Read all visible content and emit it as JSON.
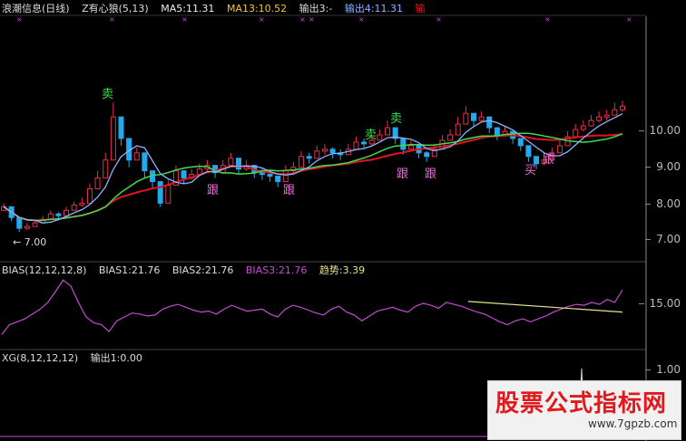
{
  "colors": {
    "up": "#e8314a",
    "down": "#22aaee",
    "ma5": "#eeeeee",
    "ma13": "#f5c33b",
    "out3_green": "#3ddc4b",
    "out3_cyan": "#1fc9d6",
    "out4": "#8ab4ff",
    "out_red": "#e3141f",
    "bias": "#c34bd1",
    "trend": "#e7e28b",
    "axis": "#888888"
  },
  "header": {
    "title": "浪潮信息(日线)",
    "indicator": "Z有心狼(5,13)",
    "ma5": "MA5:11.31",
    "ma13": "MA13:10.52",
    "out3": "输出3:-",
    "out4": "输出4:11.31",
    "out_last": "输"
  },
  "bias_header": {
    "name": "BIAS(12,12,12,8)",
    "bias1": "BIAS1:21.76",
    "bias2": "BIAS2:21.76",
    "bias3": "BIAS3:21.76",
    "trend": "趋势:3.39"
  },
  "xg_header": {
    "name": "XG(8,12,12,12)",
    "out1": "输出1:0.00"
  },
  "price_axis": [
    "10.00",
    "9.00",
    "8.00",
    "7.00"
  ],
  "bias_axis": [
    "15.00"
  ],
  "xg_axis": [
    "1.00"
  ],
  "low_marker": "← 7.00",
  "signals": {
    "sell": "卖",
    "follow": "跟",
    "buy": "买"
  },
  "watermark": {
    "title": "股票公式指标网",
    "url": "www.7gpzb.com"
  },
  "chart_data": [
    {
      "type": "candlestick",
      "title": "浪潮信息(日线)",
      "ylim": [
        6.5,
        11.0
      ],
      "x": [
        1,
        2,
        3,
        4,
        5,
        6,
        7,
        8,
        9,
        10,
        11,
        12,
        13,
        14,
        15,
        16,
        17,
        18,
        19,
        20,
        21,
        22,
        23,
        24,
        25,
        26,
        27,
        28,
        29,
        30,
        31,
        32,
        33,
        34,
        35,
        36,
        37,
        38,
        39,
        40,
        41,
        42,
        43,
        44,
        45,
        46,
        47,
        48,
        49,
        50,
        51,
        52,
        53,
        54,
        55,
        56,
        57,
        58,
        59,
        60,
        61,
        62,
        63,
        64,
        65,
        66,
        67,
        68,
        69,
        70,
        71,
        72,
        73,
        74,
        75,
        76,
        77,
        78,
        79,
        80,
        81,
        82,
        83,
        84,
        85,
        86,
        87,
        88,
        89,
        90
      ],
      "close": [
        7.9,
        7.6,
        7.3,
        7.35,
        7.45,
        7.55,
        7.7,
        7.65,
        7.8,
        7.95,
        8.0,
        8.4,
        8.7,
        9.2,
        10.4,
        9.8,
        9.2,
        9.4,
        8.9,
        8.6,
        8.0,
        8.5,
        8.9,
        8.7,
        8.8,
        8.95,
        9.05,
        8.85,
        9.05,
        9.25,
        8.95,
        9.05,
        8.85,
        8.8,
        8.75,
        8.6,
        8.9,
        9.0,
        9.3,
        9.25,
        9.45,
        9.5,
        9.4,
        9.35,
        9.5,
        9.7,
        9.65,
        9.75,
        9.9,
        10.1,
        9.8,
        9.5,
        9.6,
        9.4,
        9.3,
        9.5,
        9.75,
        9.9,
        10.2,
        10.5,
        10.3,
        10.4,
        10.1,
        9.9,
        10.0,
        9.8,
        9.6,
        9.3,
        9.1,
        9.2,
        9.4,
        9.6,
        9.85,
        10.05,
        10.15,
        10.3,
        10.4,
        10.45,
        10.6,
        10.7
      ],
      "high": [
        8.0,
        7.7,
        7.4,
        7.45,
        7.55,
        7.65,
        7.8,
        7.75,
        7.9,
        8.05,
        8.15,
        8.55,
        8.9,
        9.4,
        10.8,
        10.0,
        9.4,
        9.55,
        9.05,
        8.75,
        8.15,
        8.65,
        9.05,
        8.85,
        8.95,
        9.1,
        9.2,
        9.0,
        9.2,
        9.4,
        9.1,
        9.2,
        9.0,
        8.95,
        8.9,
        8.75,
        9.05,
        9.15,
        9.45,
        9.4,
        9.6,
        9.65,
        9.55,
        9.5,
        9.65,
        9.85,
        9.8,
        9.9,
        10.05,
        10.3,
        9.95,
        9.65,
        9.75,
        9.55,
        9.45,
        9.65,
        9.9,
        10.05,
        10.4,
        10.7,
        10.45,
        10.55,
        10.25,
        10.05,
        10.15,
        9.95,
        9.75,
        9.45,
        9.25,
        9.35,
        9.55,
        9.75,
        10.0,
        10.2,
        10.3,
        10.45,
        10.55,
        10.6,
        10.8,
        10.85
      ],
      "low": [
        7.8,
        7.5,
        7.2,
        7.25,
        7.35,
        7.45,
        7.6,
        7.55,
        7.7,
        7.85,
        7.9,
        8.3,
        8.6,
        9.0,
        10.0,
        9.6,
        9.0,
        9.2,
        8.7,
        8.4,
        7.9,
        8.35,
        8.75,
        8.55,
        8.65,
        8.8,
        8.9,
        8.7,
        8.9,
        9.1,
        8.8,
        8.9,
        8.7,
        8.65,
        8.6,
        8.45,
        8.75,
        8.85,
        9.15,
        9.1,
        9.3,
        9.35,
        9.25,
        9.2,
        9.35,
        9.55,
        9.5,
        9.6,
        9.75,
        9.95,
        9.65,
        9.35,
        9.45,
        9.25,
        9.15,
        9.35,
        9.6,
        9.75,
        10.05,
        10.3,
        10.15,
        10.25,
        9.95,
        9.75,
        9.85,
        9.65,
        9.45,
        9.15,
        8.95,
        9.05,
        9.25,
        9.45,
        9.7,
        9.9,
        10.0,
        10.15,
        10.25,
        10.3,
        10.45,
        10.55
      ]
    },
    {
      "type": "line",
      "title": "BIAS(12,12,12,8)",
      "series": [
        {
          "name": "BIAS1",
          "values": [
            11.0,
            12.0,
            12.3,
            12.6,
            13.1,
            13.6,
            14.3,
            15.4,
            16.6,
            16.0,
            14.3,
            12.8,
            12.2,
            12.0,
            11.3,
            12.4,
            12.8,
            13.2,
            13.1,
            12.9,
            13.0,
            13.6,
            13.9,
            14.1,
            13.8,
            13.5,
            13.3,
            13.4,
            13.1,
            13.6,
            14.0,
            13.7,
            13.4,
            13.5,
            13.6,
            13.1,
            12.8,
            13.6,
            14.0,
            13.8,
            13.5,
            13.2,
            13.0,
            13.6,
            13.9,
            13.3,
            13.0,
            12.4,
            12.9,
            13.4,
            13.6,
            13.8,
            13.5,
            13.3,
            13.9,
            14.2,
            14.0,
            13.7,
            14.3,
            14.1,
            13.9,
            13.6,
            13.3,
            13.1,
            12.7,
            12.3,
            12.0,
            12.4,
            12.6,
            12.3,
            12.6,
            12.9,
            13.3,
            13.6,
            13.9,
            14.1,
            14.0,
            14.3,
            14.1,
            14.6,
            14.3,
            15.6
          ]
        },
        {
          "name": "趋势",
          "values": [
            14.4,
            13.3
          ]
        }
      ]
    }
  ]
}
